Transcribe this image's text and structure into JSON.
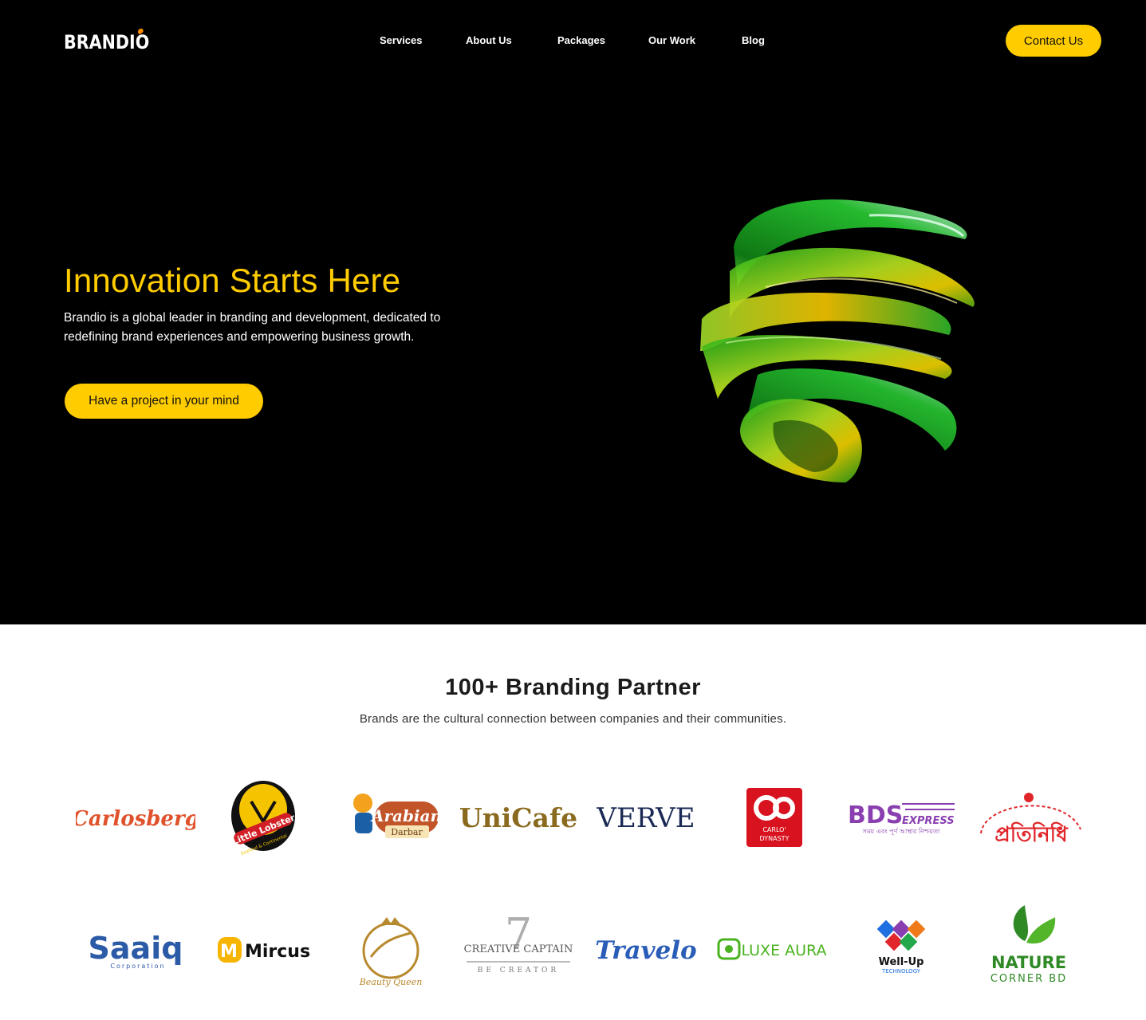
{
  "brand": {
    "name_part1": "BRANDI",
    "name_part2": "O"
  },
  "nav": {
    "items": [
      {
        "label": "Services"
      },
      {
        "label": "About Us"
      },
      {
        "label": "Packages"
      },
      {
        "label": "Our Work"
      },
      {
        "label": "Blog"
      }
    ],
    "contact_label": "Contact Us"
  },
  "hero": {
    "title": "Innovation Starts Here",
    "description": "Brandio is a global leader in branding and development, dedicated to redefining brand experiences and empowering business growth.",
    "cta_label": "Have a project in your mind"
  },
  "partners": {
    "title": "100+ Branding Partner",
    "subtitle": "Brands are the cultural connection between companies and their communities.",
    "logos": [
      {
        "name": "Carlosberg",
        "text": "Carlosberg"
      },
      {
        "name": "Little Lobster",
        "text": "Little Lobster",
        "sub": "Seafood & Continental"
      },
      {
        "name": "Arabian Darbar",
        "text": "Arabian",
        "sub": "Darbar"
      },
      {
        "name": "UniCafe",
        "text": "UniCafe"
      },
      {
        "name": "VERVE",
        "text": "VERVE"
      },
      {
        "name": "Carlo Dynasty",
        "text": "CARLO'",
        "sub": "DYNASTY"
      },
      {
        "name": "BDS Express",
        "text": "BDS",
        "sub": "EXPRESS",
        "tagline": "সময় এবং পূর্ণ আস্থার নিশ্চয়তা"
      },
      {
        "name": "Protinidhi",
        "text": "প্রতিনিধি"
      },
      {
        "name": "Saaiq",
        "text": "Saaiq",
        "sub": "Corporation"
      },
      {
        "name": "Mircus",
        "text": "Mircus"
      },
      {
        "name": "Beauty Queen",
        "text": "Beauty Queen"
      },
      {
        "name": "Creative Captain",
        "text": "CREATIVE CAPTAIN",
        "sub": "BE CREATOR"
      },
      {
        "name": "Travelo",
        "text": "Travelo"
      },
      {
        "name": "Luxe Aura",
        "text": "LUXE AURA"
      },
      {
        "name": "Well-Up Technology",
        "text": "Well-Up",
        "sub": "TECHNOLOGY"
      },
      {
        "name": "Nature Corner BD",
        "text": "NATURE",
        "sub": "CORNER BD"
      }
    ]
  },
  "colors": {
    "accent": "#ffcc00",
    "hero_bg": "#000000",
    "page_bg": "#ffffff"
  }
}
